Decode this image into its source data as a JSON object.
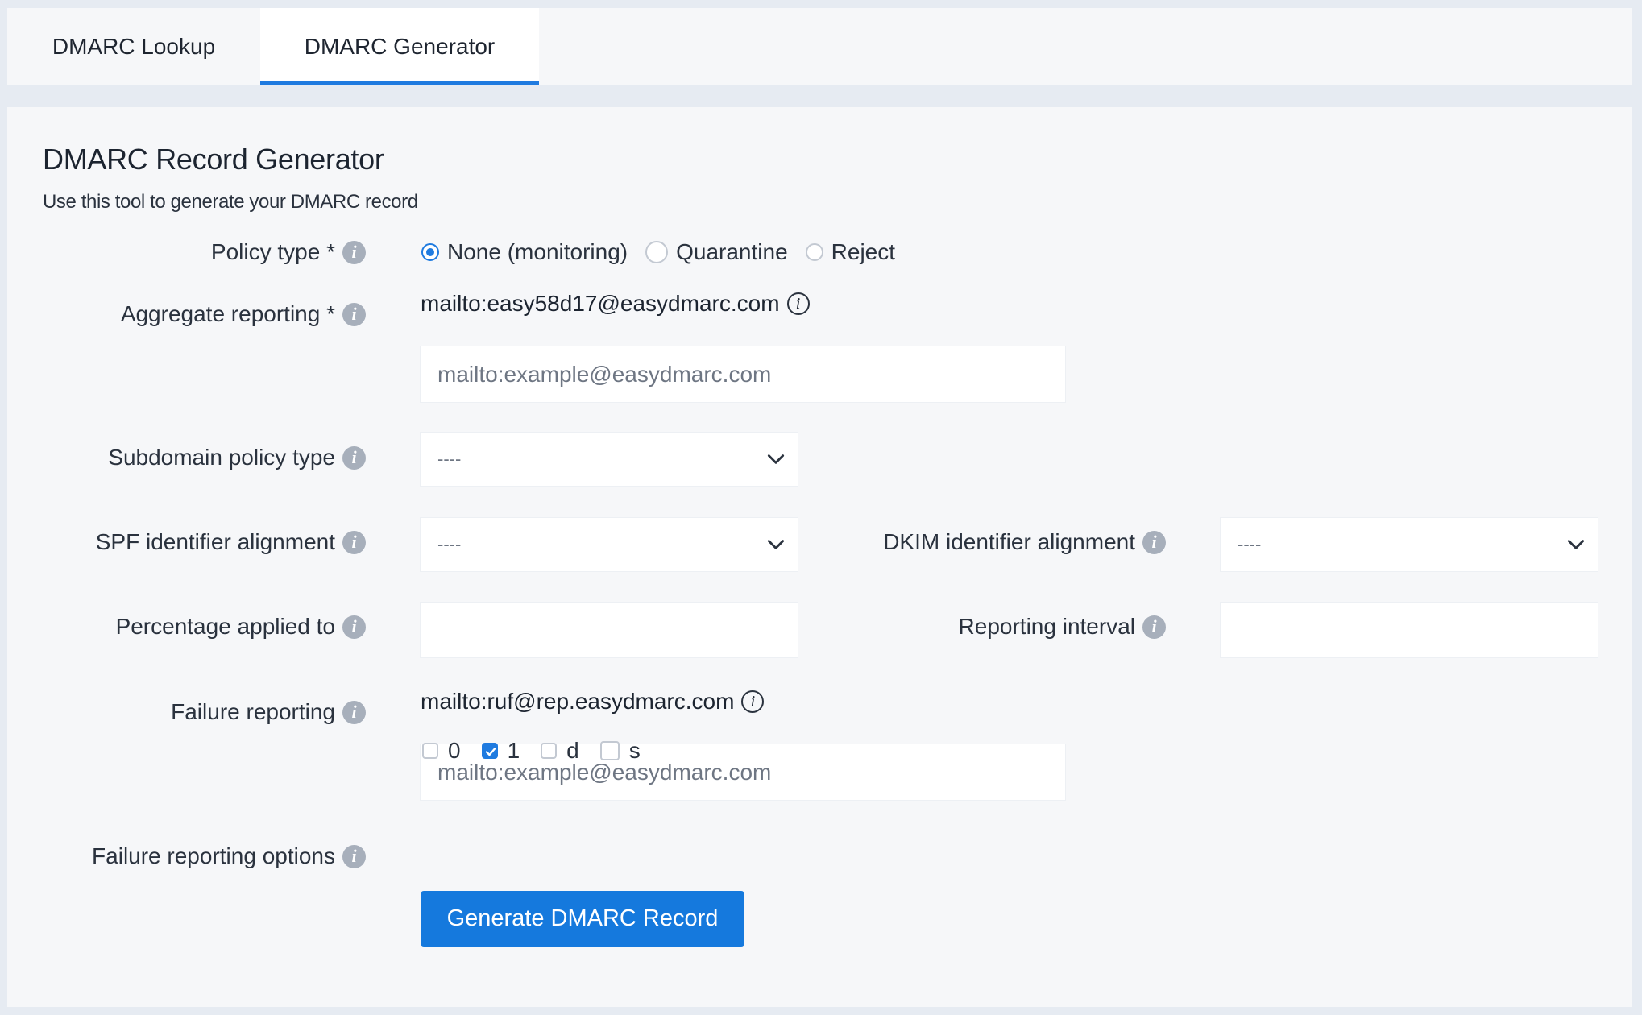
{
  "tabs": [
    {
      "label": "DMARC Lookup"
    },
    {
      "label": "DMARC Generator",
      "active": true
    }
  ],
  "header": {
    "title": "DMARC Record Generator",
    "subtitle": "Use this tool to generate your DMARC record"
  },
  "policy_type": {
    "label": "Policy type *",
    "options": [
      "None (monitoring)",
      "Quarantine",
      "Reject"
    ],
    "selected": "None (monitoring)"
  },
  "aggregate_reporting": {
    "label": "Aggregate reporting *",
    "default_address": "mailto:easy58d17@easydmarc.com",
    "value": "",
    "placeholder": "mailto:example@easydmarc.com"
  },
  "subdomain_policy": {
    "label": "Subdomain policy type",
    "selected": "----"
  },
  "spf_alignment": {
    "label": "SPF identifier alignment",
    "selected": "----"
  },
  "dkim_alignment": {
    "label": "DKIM identifier alignment",
    "selected": "----"
  },
  "percentage": {
    "label": "Percentage applied to",
    "value": ""
  },
  "reporting_interval": {
    "label": "Reporting interval",
    "value": ""
  },
  "failure_reporting": {
    "label": "Failure reporting",
    "default_address": "mailto:ruf@rep.easydmarc.com",
    "value": "",
    "placeholder": "mailto:example@easydmarc.com"
  },
  "failure_options": {
    "label": "Failure reporting options",
    "options": [
      {
        "label": "0",
        "checked": false
      },
      {
        "label": "1",
        "checked": true
      },
      {
        "label": "d",
        "checked": false
      },
      {
        "label": "s",
        "checked": false
      }
    ]
  },
  "generate_button": {
    "label": "Generate DMARC Record"
  },
  "icons": {
    "info": "info-icon",
    "dropdown": "chevron-down-icon",
    "check": "checkmark-icon"
  },
  "colors": {
    "accent": "#1f7be0",
    "button": "#1579dd",
    "background": "#e6ebf2",
    "panel": "#f6f7f9"
  }
}
